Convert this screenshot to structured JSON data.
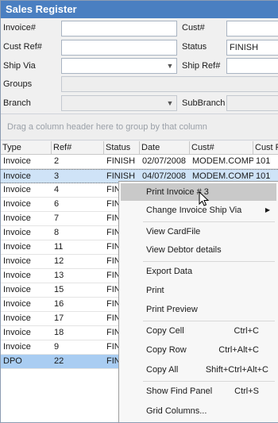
{
  "window": {
    "title": "Sales Register"
  },
  "form": {
    "invoice_label": "Invoice#",
    "invoice_value": "",
    "cust_label": "Cust#",
    "cust_value": "",
    "cust_ref_label": "Cust Ref#",
    "cust_ref_value": "",
    "status_label": "Status",
    "status_value": "FINISH",
    "ship_via_label": "Ship Via",
    "ship_via_value": "",
    "ship_ref_label": "Ship Ref#",
    "ship_ref_value": "",
    "groups_label": "Groups",
    "groups_value": "",
    "branch_label": "Branch",
    "branch_value": "",
    "subbranch_label": "SubBranch",
    "subbranch_value": ""
  },
  "group_panel": {
    "hint": "Drag a column header here to group by that column"
  },
  "grid": {
    "columns": [
      "Type",
      "Ref#",
      "Status",
      "Date",
      "Cust#",
      "Cust R"
    ],
    "rows": [
      {
        "type": "Invoice",
        "ref": "2",
        "status": "FINISH",
        "date": "02/07/2008",
        "cust": "MODEM.COMP",
        "custr": "101"
      },
      {
        "type": "Invoice",
        "ref": "3",
        "status": "FINISH",
        "date": "04/07/2008",
        "cust": "MODEM.COMP",
        "custr": "101"
      },
      {
        "type": "Invoice",
        "ref": "4",
        "status": "FIN",
        "date": "",
        "cust": "",
        "custr": ""
      },
      {
        "type": "Invoice",
        "ref": "6",
        "status": "FIN",
        "date": "",
        "cust": "",
        "custr": ""
      },
      {
        "type": "Invoice",
        "ref": "7",
        "status": "FIN",
        "date": "",
        "cust": "",
        "custr": ""
      },
      {
        "type": "Invoice",
        "ref": "8",
        "status": "FIN",
        "date": "",
        "cust": "",
        "custr": ""
      },
      {
        "type": "Invoice",
        "ref": "11",
        "status": "FIN",
        "date": "",
        "cust": "",
        "custr": ""
      },
      {
        "type": "Invoice",
        "ref": "12",
        "status": "FIN",
        "date": "",
        "cust": "",
        "custr": ""
      },
      {
        "type": "Invoice",
        "ref": "13",
        "status": "FIN",
        "date": "",
        "cust": "",
        "custr": ""
      },
      {
        "type": "Invoice",
        "ref": "15",
        "status": "FIN",
        "date": "",
        "cust": "",
        "custr": ""
      },
      {
        "type": "Invoice",
        "ref": "16",
        "status": "FIN",
        "date": "",
        "cust": "",
        "custr": ""
      },
      {
        "type": "Invoice",
        "ref": "17",
        "status": "FIN",
        "date": "",
        "cust": "",
        "custr": ""
      },
      {
        "type": "Invoice",
        "ref": "18",
        "status": "FIN",
        "date": "",
        "cust": "",
        "custr": ""
      },
      {
        "type": "Invoice",
        "ref": "9",
        "status": "FIN",
        "date": "",
        "cust": "",
        "custr": ""
      },
      {
        "type": "DPO",
        "ref": "22",
        "status": "FIN",
        "date": "",
        "cust": "",
        "custr": ""
      }
    ]
  },
  "context_menu": {
    "items": [
      {
        "label": "Print Invoice # 3",
        "shortcut": ""
      },
      {
        "label": "Change Invoice Ship Via",
        "shortcut": ""
      },
      {
        "label": "View CardFile",
        "shortcut": ""
      },
      {
        "label": "View Debtor details",
        "shortcut": ""
      },
      {
        "label": "Export Data",
        "shortcut": ""
      },
      {
        "label": "Print",
        "shortcut": ""
      },
      {
        "label": "Print Preview",
        "shortcut": ""
      },
      {
        "label": "Copy Cell",
        "shortcut": "Ctrl+C"
      },
      {
        "label": "Copy Row",
        "shortcut": "Ctrl+Alt+C"
      },
      {
        "label": "Copy All",
        "shortcut": "Shift+Ctrl+Alt+C"
      },
      {
        "label": "Show Find Panel",
        "shortcut": "Ctrl+S"
      },
      {
        "label": "Grid Columns...",
        "shortcut": ""
      }
    ]
  },
  "colors": {
    "title_bar": "#4a7fc1",
    "selected_row": "#cfe3f7",
    "alt_row": "#a9cdf2",
    "menu_highlight": "#c9c9c9"
  }
}
